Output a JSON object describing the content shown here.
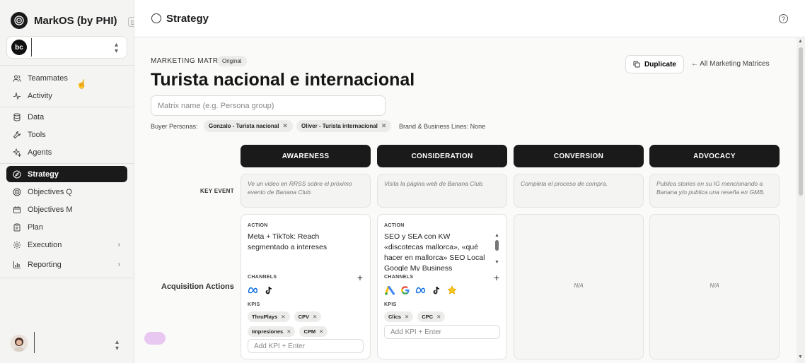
{
  "app": {
    "name": "MarkOS (by PHI)",
    "workspace_initials": "bc"
  },
  "sidebar": {
    "items": [
      {
        "label": "Teammates",
        "icon": "users-icon"
      },
      {
        "label": "Activity",
        "icon": "activity-icon"
      },
      {
        "label": "Data",
        "icon": "database-icon"
      },
      {
        "label": "Tools",
        "icon": "wrench-icon"
      },
      {
        "label": "Agents",
        "icon": "sparkle-icon"
      },
      {
        "label": "Strategy",
        "icon": "compass-icon",
        "active": true
      },
      {
        "label": "Objectives Q",
        "icon": "target-icon"
      },
      {
        "label": "Objectives M",
        "icon": "calendar-icon"
      },
      {
        "label": "Plan",
        "icon": "clipboard-icon"
      },
      {
        "label": "Execution",
        "icon": "gear-icon",
        "expandable": true
      },
      {
        "label": "Reporting",
        "icon": "bar-chart-icon",
        "expandable": true
      }
    ]
  },
  "header": {
    "title": "Strategy"
  },
  "matrix": {
    "eyebrow": "MARKETING MATRIX",
    "badge": "Original",
    "title": "Turista nacional e internacional",
    "name_placeholder": "Matrix name (e.g. Persona group)",
    "duplicate_label": "Duplicate",
    "all_link": "← All Marketing Matrices",
    "buyer_personas_label": "Buyer Personas:",
    "personas": [
      "Gonzalo - Turista nacional",
      "Oliver - Turista internacional"
    ],
    "brand_label": "Brand & Business Lines:",
    "brand_value": "None"
  },
  "stages": [
    "AWARENESS",
    "CONSIDERATION",
    "CONVERSION",
    "ADVOCACY"
  ],
  "rows": {
    "key_event_label": "KEY EVENT",
    "acquisition_label": "Acquisition Actions"
  },
  "key_events": [
    "Ve un video en RRSS sobre el próximo evento de Banana Club.",
    "Visita la página web de Banana Club.",
    "Completa el proceso de compra.",
    "Publica stories en su IG mencionando a Banana y/o publica una reseña en GMB."
  ],
  "labels": {
    "action": "ACTION",
    "channels": "CHANNELS",
    "kpis": "KPIS",
    "kpi_placeholder": "Add KPI + Enter",
    "na": "N/A"
  },
  "acquisition": [
    {
      "action": "Meta + TikTok: Reach segmentado a intereses",
      "channels": [
        "meta-icon",
        "tiktok-icon"
      ],
      "kpis": [
        "ThruPlays",
        "CPV",
        "Impresiones",
        "CPM"
      ]
    },
    {
      "action": "SEO y SEA con KW «discotecas mallorca», «qué hacer en mallorca» SEO Local Google My Business",
      "channels": [
        "google-ads-icon",
        "google-icon",
        "meta-icon",
        "tiktok-icon",
        "star-icon"
      ],
      "kpis": [
        "Clics",
        "CPC"
      ]
    }
  ],
  "colors": {
    "accent_dark": "#1a1a1a",
    "chip_bg": "#ececea",
    "meta_blue": "#0668e1",
    "google_blue": "#4285f4",
    "google_red": "#ea4335",
    "google_yellow": "#fbbc04",
    "google_green": "#34a853",
    "star_gold": "#f5c518"
  }
}
